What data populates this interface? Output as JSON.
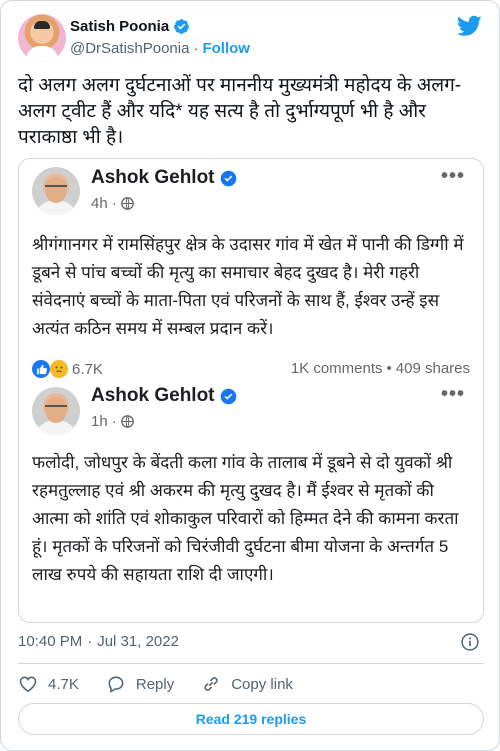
{
  "author": {
    "name": "Satish Poonia",
    "handle": "@DrSatishPoonia",
    "separator": "·",
    "follow_label": "Follow"
  },
  "tweet": {
    "text": "दो अलग अलग दुर्घटनाओं पर माननीय मुख्यमंत्री महोदय के अलग-अलग ट्वीट हैं और यदि* यह सत्य है तो दुर्भाग्यपूर्ण भी है और पराकाष्ठा भी है।",
    "time": "10:40 PM",
    "date_separator": "·",
    "date": "Jul 31, 2022"
  },
  "embedded": {
    "post1": {
      "name": "Ashok Gehlot",
      "time": "4h",
      "meta_separator": "·",
      "body": "श्रीगंगानगर में रामसिंहपुर क्षेत्र के उदासर गांव में खेत में पानी की डिग्गी में डूबने से पांच बच्चों की मृत्यु का समाचार बेहद दुखद है। मेरी गहरी संवेदनाएं बच्चों के माता-पिता एवं परिजनों के साथ हैं, ईश्वर उन्हें इस अत्यंत कठिन समय में सम्बल प्रदान करें।",
      "reaction_count": "6.7K",
      "comments": "1K comments",
      "stats_separator": "•",
      "shares": "409 shares",
      "more_label": "•••"
    },
    "post2": {
      "name": "Ashok Gehlot",
      "time": "1h",
      "meta_separator": "·",
      "body": "फलोदी, जोधपुर के बेंदती कला गांव के तालाब में डूबने से दो युवकों श्री रहमतुल्लाह एवं श्री अकरम की मृत्यु दुखद है। मैं ईश्वर से मृतकों की आत्मा को शांति एवं शोकाकुल परिवारों को हिम्मत देने की कामना करता हूं। मृतकों के परिजनों को चिरंजीवी दुर्घटना बीमा योजना के अन्तर्गत 5 लाख रुपये की सहायता राशि दी जाएगी।",
      "more_label": "•••"
    }
  },
  "actions": {
    "like_count": "4.7K",
    "reply_label": "Reply",
    "copy_label": "Copy link"
  },
  "read_replies_label": "Read 219 replies",
  "colors": {
    "twitter_blue": "#1d9bf0",
    "facebook_blue": "#1877f2",
    "text_primary": "#0f1419",
    "text_secondary": "#536471"
  },
  "icons": {
    "verified": "verified-badge-icon",
    "twitter": "twitter-bird-icon",
    "globe": "globe-icon",
    "info": "info-icon",
    "heart": "heart-icon",
    "reply": "reply-bubble-icon",
    "link": "link-icon"
  }
}
